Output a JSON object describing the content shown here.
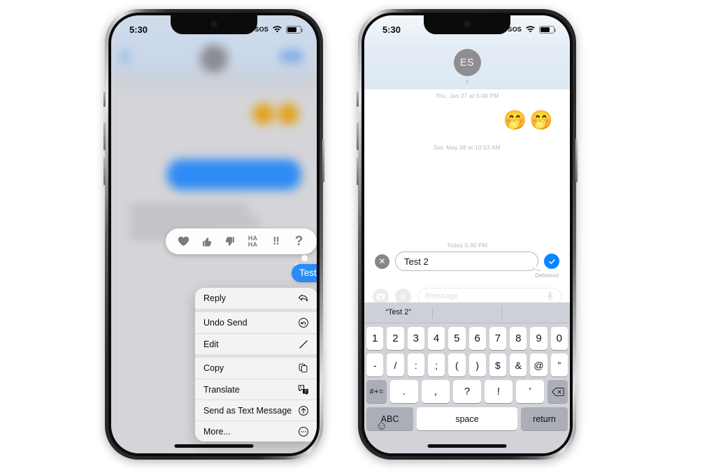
{
  "meta": {
    "background": "#ffffff"
  },
  "left_phone": {
    "status_bar": {
      "time": "5:30",
      "sos": "SOS",
      "wifi_icon": "wifi-icon",
      "battery_icon": "battery-icon"
    },
    "thread": {
      "blurred": true,
      "back_icon": "back-chevron-icon",
      "avatar_icon": "contact-avatar",
      "video_icon": "facetime-icon",
      "emoji_blob": "🟡🟡",
      "redacted_bubble": "blurred-blue-bubble",
      "redacted_text_lines": 3
    },
    "tapback_bar": {
      "name": "tapback-reaction-bar",
      "reactions": [
        {
          "id": "heart",
          "glyph": "♥",
          "label": "Love"
        },
        {
          "id": "thumbs-up",
          "glyph": "👍",
          "label": "Like"
        },
        {
          "id": "thumbs-down",
          "glyph": "👎",
          "label": "Dislike"
        },
        {
          "id": "haha",
          "glyph": "HA\nHA",
          "label": "Haha"
        },
        {
          "id": "exclamation",
          "glyph": "‼",
          "label": "Emphasize"
        },
        {
          "id": "question",
          "glyph": "?",
          "label": "Question"
        }
      ]
    },
    "selected_message": {
      "text": "Test",
      "color": "#2a8cf6"
    },
    "context_menu": {
      "groups": [
        [
          {
            "label": "Reply",
            "icon": "reply-arrow-icon"
          }
        ],
        [
          {
            "label": "Undo Send",
            "icon": "undo-send-icon"
          },
          {
            "label": "Edit",
            "icon": "pencil-icon"
          }
        ],
        [
          {
            "label": "Copy",
            "icon": "copy-icon"
          },
          {
            "label": "Translate",
            "icon": "translate-icon"
          },
          {
            "label": "Send as Text Message",
            "icon": "arrow-up-circle-icon"
          },
          {
            "label": "More...",
            "icon": "ellipsis-circle-icon"
          }
        ]
      ]
    }
  },
  "right_phone": {
    "status_bar": {
      "time": "5:30",
      "sos": "SOS",
      "wifi_icon": "wifi-icon",
      "battery_icon": "battery-icon"
    },
    "header": {
      "avatar_initials": "ES",
      "chevron": "›"
    },
    "thread": {
      "timestamps": [
        "Thu, Jan 27 at 5:49 PM",
        "Sat, May 28 at 10:53 AM",
        "Today 5:30 PM"
      ],
      "emoji_message": "🤭🤭"
    },
    "edit_composer": {
      "cancel_icon": "close-circle-icon",
      "value": "Test 2",
      "confirm_icon": "checkmark-circle-icon",
      "confirm_color": "#0a84ff",
      "status": "Delivered"
    },
    "message_bar": {
      "camera_icon": "camera-icon",
      "apps_icon": "app-store-icon",
      "placeholder": "iMessage",
      "mic_icon": "microphone-icon"
    },
    "keyboard": {
      "predictive": [
        "“Test 2”",
        "",
        ""
      ],
      "row1": [
        "1",
        "2",
        "3",
        "4",
        "5",
        "6",
        "7",
        "8",
        "9",
        "0"
      ],
      "row2": [
        "-",
        "/",
        ":",
        ";",
        "(",
        ")",
        "$",
        "&",
        "@",
        "”"
      ],
      "row3": {
        "shift_label": "#+=",
        "keys": [
          ".",
          ",",
          "?",
          "!",
          "’"
        ],
        "backspace_icon": "backspace-icon"
      },
      "row4": {
        "abc": "ABC",
        "space": "space",
        "return": "return"
      },
      "emoji_key_icon": "emoji-smiley-icon"
    }
  }
}
